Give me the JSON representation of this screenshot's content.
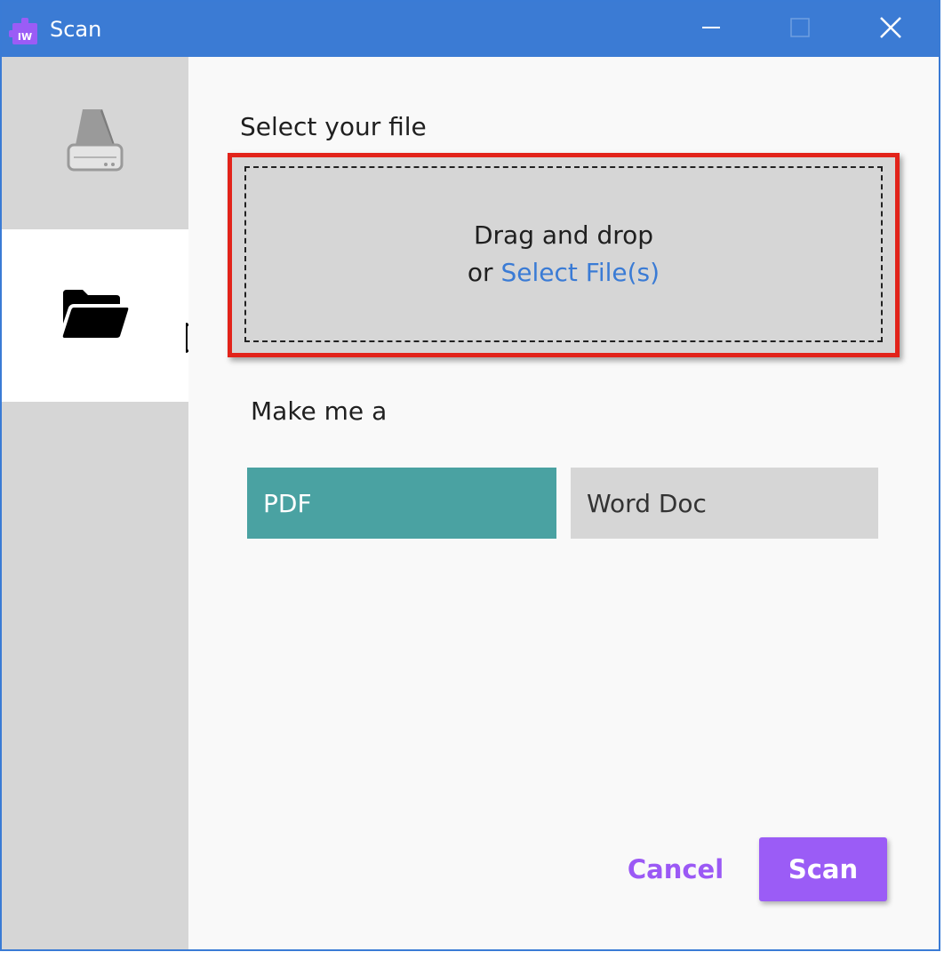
{
  "window": {
    "title": "Scan",
    "app_icon_text": "IW",
    "app_icon": "app-puzzle-icon",
    "controls": {
      "minimize_icon": "minimize-icon",
      "maximize_icon": "maximize-icon",
      "close_icon": "close-icon"
    },
    "titlebar_color": "#3b7bd4"
  },
  "sidebar": {
    "items": [
      {
        "id": "scanner",
        "icon": "scanner-icon",
        "selected": false
      },
      {
        "id": "file",
        "icon": "folder-open-icon",
        "selected": true
      }
    ]
  },
  "main": {
    "select_label": "Select your file",
    "dropzone": {
      "line1": "Drag and drop",
      "line2_prefix": "or",
      "link_text": "Select File(s)",
      "highlight_color": "#e2231a"
    },
    "make_label": "Make me a",
    "formats": [
      {
        "label": "PDF",
        "selected": true,
        "color": "#4aa2a2"
      },
      {
        "label": "Word Doc",
        "selected": false,
        "color": "#d6d6d6"
      }
    ],
    "actions": {
      "cancel_label": "Cancel",
      "scan_label": "Scan",
      "accent_color": "#9b5cf6"
    }
  }
}
